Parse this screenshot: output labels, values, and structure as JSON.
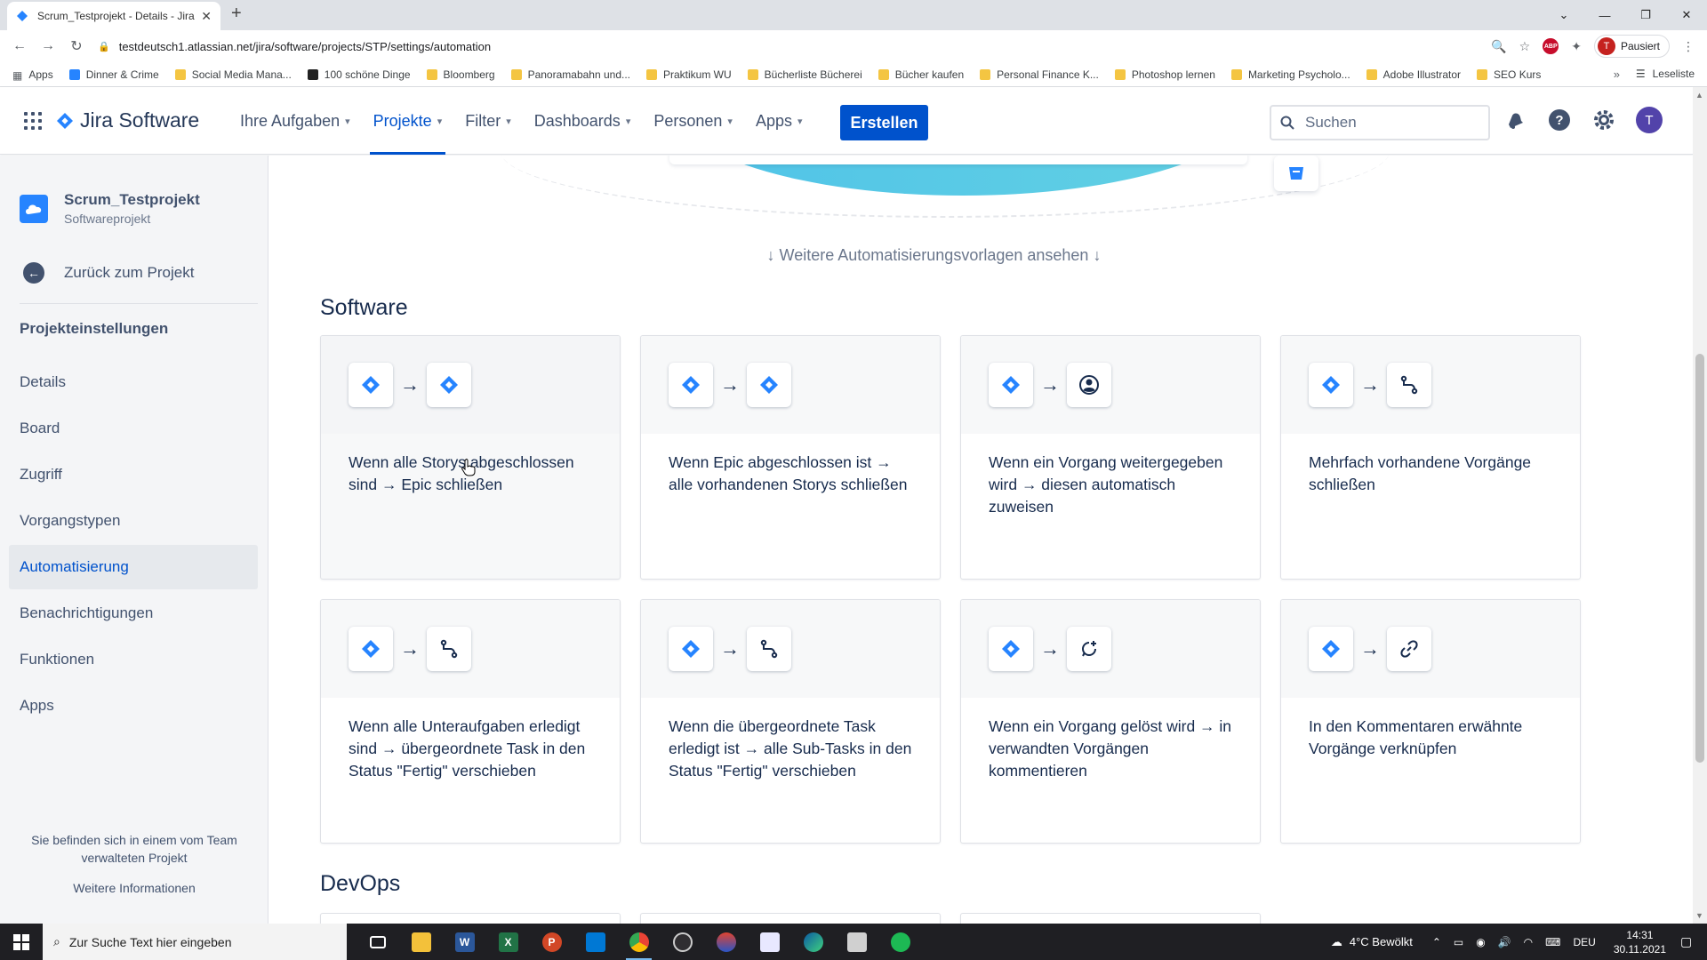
{
  "browser": {
    "tab_title": "Scrum_Testprojekt - Details - Jira",
    "url": "testdeutsch1.atlassian.net/jira/software/projects/STP/settings/automation",
    "profile_label": "Pausiert",
    "profile_initial": "T",
    "bookmarks": [
      "Apps",
      "Dinner & Crime",
      "Social Media Mana...",
      "100 schöne Dinge",
      "Bloomberg",
      "Panoramabahn und...",
      "Praktikum WU",
      "Bücherliste Bücherei",
      "Bücher kaufen",
      "Personal Finance K...",
      "Photoshop lernen",
      "Marketing Psycholo...",
      "Adobe Illustrator",
      "SEO Kurs"
    ],
    "reading_list": "Leseliste"
  },
  "nav": {
    "logo": "Jira Software",
    "items": [
      {
        "label": "Ihre Aufgaben"
      },
      {
        "label": "Projekte"
      },
      {
        "label": "Filter"
      },
      {
        "label": "Dashboards"
      },
      {
        "label": "Personen"
      },
      {
        "label": "Apps"
      }
    ],
    "create_label": "Erstellen",
    "search_placeholder": "Suchen",
    "user_initial": "T"
  },
  "sidebar": {
    "project_name": "Scrum_Testprojekt",
    "project_type": "Softwareprojekt",
    "back_label": "Zurück zum Projekt",
    "section_title": "Projekteinstellungen",
    "items": [
      {
        "label": "Details"
      },
      {
        "label": "Board"
      },
      {
        "label": "Zugriff"
      },
      {
        "label": "Vorgangstypen"
      },
      {
        "label": "Automatisierung"
      },
      {
        "label": "Benachrichtigungen"
      },
      {
        "label": "Funktionen"
      },
      {
        "label": "Apps"
      }
    ],
    "footer_text": "Sie befinden sich in einem vom Team verwalteten Projekt",
    "footer_link": "Weitere Informationen"
  },
  "main": {
    "more_templates": "Weitere Automatisierungsvorlagen ansehen",
    "section_software": "Software",
    "section_devops": "DevOps",
    "arrow": "→",
    "cards": [
      {
        "text": "Wenn alle Storys abgeschlossen sind → Epic schließen",
        "to_icon": "jira-icon"
      },
      {
        "text": "Wenn Epic abgeschlossen ist → alle vorhandenen Storys schließen",
        "to_icon": "jira-icon"
      },
      {
        "text": "Wenn ein Vorgang weitergegeben wird → diesen automatisch zuweisen",
        "to_icon": "user-icon"
      },
      {
        "text": "Mehrfach vorhandene Vorgänge schließen",
        "to_icon": "branch-icon"
      },
      {
        "text": "Wenn alle Unteraufgaben erledigt sind → übergeordnete Task in den Status \"Fertig\" verschieben",
        "to_icon": "branch-icon"
      },
      {
        "text": "Wenn die übergeordnete Task erledigt ist → alle Sub-Tasks in den Status \"Fertig\" verschieben",
        "to_icon": "branch-icon"
      },
      {
        "text": "Wenn ein Vorgang gelöst wird → in verwandten Vorgängen kommentieren",
        "to_icon": "comment-icon"
      },
      {
        "text": "In den Kommentaren erwähnte Vorgänge verknüpfen",
        "to_icon": "link-icon"
      }
    ]
  },
  "taskbar": {
    "search_placeholder": "Zur Suche Text hier eingeben",
    "weather": "4°C  Bewölkt",
    "language": "DEU",
    "time": "14:31",
    "date": "30.11.2021"
  },
  "colors": {
    "jira_blue": "#0052cc",
    "icon_blue": "#2684ff"
  }
}
